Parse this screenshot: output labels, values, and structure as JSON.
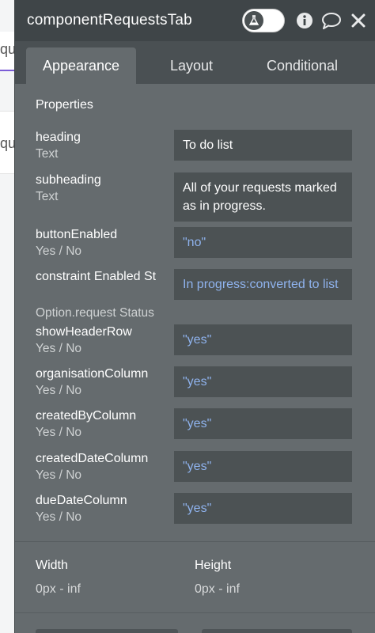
{
  "background": {
    "frag1": "qu",
    "frag2": "qu"
  },
  "panel": {
    "title": "componentRequestsTab",
    "icons": [
      "flask-icon",
      "info-icon",
      "comment-icon",
      "close-icon"
    ]
  },
  "tabs": [
    {
      "label": "Appearance",
      "active": true
    },
    {
      "label": "Layout",
      "active": false
    },
    {
      "label": "Conditional",
      "active": false
    }
  ],
  "properties": {
    "title": "Properties",
    "rows": [
      {
        "name": "heading",
        "type": "Text",
        "value": "To do list",
        "dynamic": false
      },
      {
        "name": "subheading",
        "type": "Text",
        "value": "All of your requests marked as in progress.",
        "dynamic": false
      },
      {
        "name": "buttonEnabled",
        "type": "Yes / No",
        "value": "\"no\"",
        "dynamic": true
      },
      {
        "name": "constraint Enabled St",
        "type": "Option.request Status",
        "value": "In progress:converted to list",
        "dynamic": true
      },
      {
        "name": "showHeaderRow",
        "type": "Yes / No",
        "value": "\"yes\"",
        "dynamic": true
      },
      {
        "name": "organisationColumn",
        "type": "Yes / No",
        "value": "\"yes\"",
        "dynamic": true
      },
      {
        "name": "createdByColumn",
        "type": "Yes / No",
        "value": "\"yes\"",
        "dynamic": true
      },
      {
        "name": "createdDateColumn",
        "type": "Yes / No",
        "value": "\"yes\"",
        "dynamic": true
      },
      {
        "name": "dueDateColumn",
        "type": "Yes / No",
        "value": "\"yes\"",
        "dynamic": true
      }
    ]
  },
  "dimensions": {
    "width_label": "Width",
    "width_value": "0px - inf",
    "height_label": "Height",
    "height_value": "0px - inf"
  },
  "colors": {
    "panel_bg": "#656b6e",
    "titlebar_bg": "#3f4548",
    "field_bg": "#4c5254",
    "dynamic_value": "#8fb3ee"
  }
}
